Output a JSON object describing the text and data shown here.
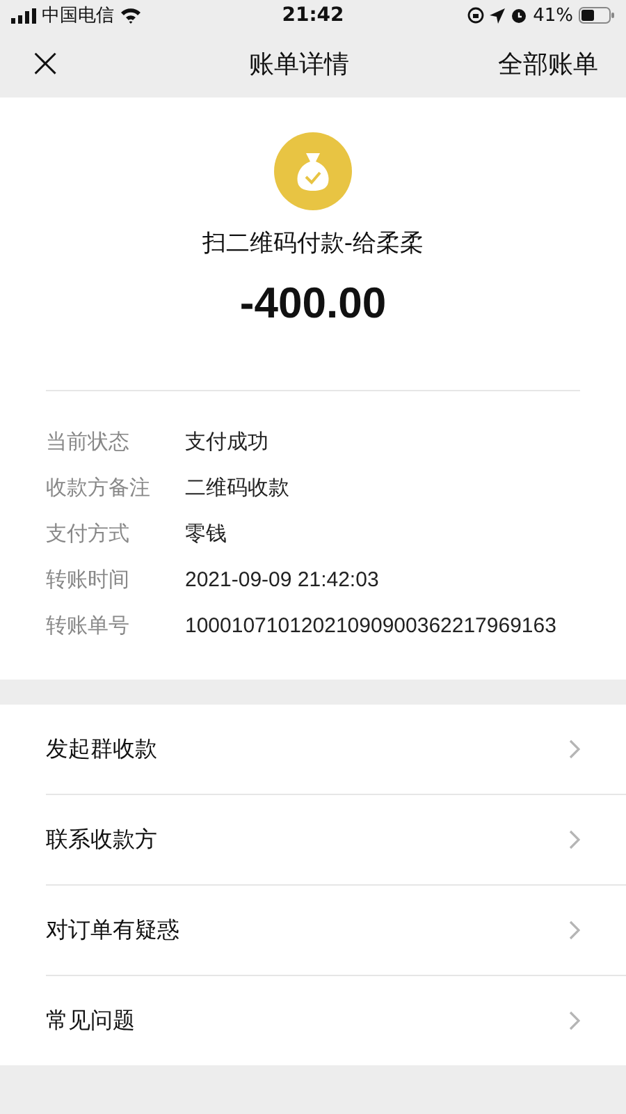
{
  "status_bar": {
    "carrier": "中国电信",
    "time": "21:42",
    "battery": "41%"
  },
  "nav": {
    "close": "×",
    "title": "账单详情",
    "action": "全部账单"
  },
  "bill": {
    "title": "扫二维码付款-给柔柔",
    "amount": "-400.00"
  },
  "details": [
    {
      "label": "当前状态",
      "value": "支付成功"
    },
    {
      "label": "收款方备注",
      "value": "二维码收款"
    },
    {
      "label": "支付方式",
      "value": "零钱"
    },
    {
      "label": "转账时间",
      "value": "2021-09-09 21:42:03"
    },
    {
      "label": "转账单号",
      "value": "10001071012021090900362217969163"
    }
  ],
  "menu": [
    {
      "label": "发起群收款"
    },
    {
      "label": "联系收款方"
    },
    {
      "label": "对订单有疑惑"
    },
    {
      "label": "常见问题"
    }
  ]
}
